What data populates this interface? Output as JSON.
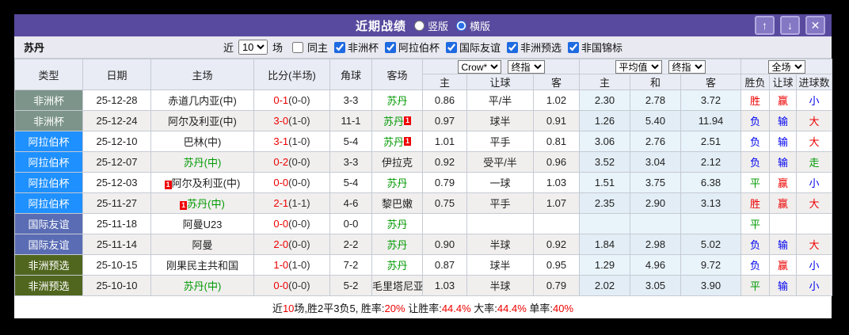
{
  "colors": {
    "accent_purple": "#584a9e",
    "sudan_green": "#009900",
    "score_red": "#ee0000",
    "badge_red": "#ee0000",
    "result_red": "#ee0000",
    "result_blue": "#0000ee",
    "result_green": "#009900",
    "type_colors": {
      "africa_cup": "#7c948a",
      "arab_cup": "#1e90ff",
      "friendly": "#5a6cb4",
      "africa_qual": "#50661e"
    }
  },
  "titlebar": {
    "title": "近期战绩",
    "radio_vertical": "竖版",
    "radio_horizontal": "横版",
    "up_icon": "↑",
    "down_icon": "↓",
    "close_icon": "✕"
  },
  "filterbar": {
    "team": "苏丹",
    "near_label": "近",
    "count_value": "10",
    "matches_label": "场",
    "same_home_label": "同主",
    "filters": [
      "非洲杯",
      "阿拉伯杯",
      "国际友谊",
      "非洲预选",
      "非国锦标"
    ]
  },
  "table": {
    "headers": {
      "type": "类型",
      "date": "日期",
      "home": "主场",
      "score": "比分(半场)",
      "corners": "角球",
      "away": "客场",
      "sub_home1": "主",
      "sub_handicap1": "让球",
      "sub_away1": "客",
      "sub_home2": "主",
      "sub_draw": "和",
      "sub_away2": "客",
      "sub_result": "胜负",
      "sub_handicap2": "让球",
      "sub_goals": "进球数"
    },
    "selects": {
      "odds_source": "Crow*",
      "final_odds_1": "终指",
      "average": "平均值",
      "final_odds_2": "终指",
      "scope": "全场"
    },
    "result_color_map": {
      "胜": "#ee0000",
      "负": "#0000ee",
      "平": "#009900",
      "赢": "#ee0000",
      "输": "#0000ee",
      "大": "#ee0000",
      "小": "#0000ee",
      "走": "#009900"
    },
    "rows": [
      {
        "type": "非洲杯",
        "type_key": "africa_cup",
        "date": "25-12-28",
        "home": "赤道几内亚(中)",
        "home_badge": false,
        "home_sudan": false,
        "score": "0-1",
        "half": "(0-0)",
        "corners": "3-3",
        "away": "苏丹",
        "away_badge": false,
        "away_sudan": true,
        "odds_home": "0.86",
        "handicap": "平/半",
        "odds_away": "1.02",
        "avg_home": "2.30",
        "avg_draw": "2.78",
        "avg_away": "3.72",
        "result": "胜",
        "handicap_result": "赢",
        "goals": "小"
      },
      {
        "type": "非洲杯",
        "type_key": "africa_cup",
        "date": "25-12-24",
        "home": "阿尔及利亚(中)",
        "home_badge": false,
        "home_sudan": false,
        "score": "3-0",
        "half": "(1-0)",
        "corners": "11-1",
        "away": "苏丹",
        "away_badge": true,
        "away_sudan": true,
        "odds_home": "0.97",
        "handicap": "球半",
        "odds_away": "0.91",
        "avg_home": "1.26",
        "avg_draw": "5.40",
        "avg_away": "11.94",
        "result": "负",
        "handicap_result": "输",
        "goals": "大"
      },
      {
        "type": "阿拉伯杯",
        "type_key": "arab_cup",
        "date": "25-12-10",
        "home": "巴林(中)",
        "home_badge": false,
        "home_sudan": false,
        "score": "3-1",
        "half": "(1-0)",
        "corners": "5-4",
        "away": "苏丹",
        "away_badge": true,
        "away_sudan": true,
        "odds_home": "1.01",
        "handicap": "平手",
        "odds_away": "0.81",
        "avg_home": "3.06",
        "avg_draw": "2.76",
        "avg_away": "2.51",
        "result": "负",
        "handicap_result": "输",
        "goals": "大"
      },
      {
        "type": "阿拉伯杯",
        "type_key": "arab_cup",
        "date": "25-12-07",
        "home": "苏丹(中)",
        "home_badge": false,
        "home_sudan": true,
        "score": "0-2",
        "half": "(0-0)",
        "corners": "3-3",
        "away": "伊拉克",
        "away_badge": false,
        "away_sudan": false,
        "odds_home": "0.92",
        "handicap": "受平/半",
        "odds_away": "0.96",
        "avg_home": "3.52",
        "avg_draw": "3.04",
        "avg_away": "2.12",
        "result": "负",
        "handicap_result": "输",
        "goals": "走"
      },
      {
        "type": "阿拉伯杯",
        "type_key": "arab_cup",
        "date": "25-12-03",
        "home": "阿尔及利亚(中)",
        "home_badge": true,
        "home_sudan": false,
        "score": "0-0",
        "half": "(0-0)",
        "corners": "5-4",
        "away": "苏丹",
        "away_badge": false,
        "away_sudan": true,
        "odds_home": "0.79",
        "handicap": "一球",
        "odds_away": "1.03",
        "avg_home": "1.51",
        "avg_draw": "3.75",
        "avg_away": "6.38",
        "result": "平",
        "handicap_result": "赢",
        "goals": "小"
      },
      {
        "type": "阿拉伯杯",
        "type_key": "arab_cup",
        "date": "25-11-27",
        "home": "苏丹(中)",
        "home_badge": true,
        "home_sudan": true,
        "score": "2-1",
        "half": "(1-1)",
        "corners": "4-6",
        "away": "黎巴嫩",
        "away_badge": false,
        "away_sudan": false,
        "odds_home": "0.75",
        "handicap": "平手",
        "odds_away": "1.07",
        "avg_home": "2.35",
        "avg_draw": "2.90",
        "avg_away": "3.13",
        "result": "胜",
        "handicap_result": "赢",
        "goals": "大"
      },
      {
        "type": "国际友谊",
        "type_key": "friendly",
        "date": "25-11-18",
        "home": "阿曼U23",
        "home_badge": false,
        "home_sudan": false,
        "score": "0-0",
        "half": "(0-0)",
        "corners": "0-0",
        "away": "苏丹",
        "away_badge": false,
        "away_sudan": true,
        "odds_home": "",
        "handicap": "",
        "odds_away": "",
        "avg_home": "",
        "avg_draw": "",
        "avg_away": "",
        "result": "平",
        "handicap_result": "",
        "goals": ""
      },
      {
        "type": "国际友谊",
        "type_key": "friendly",
        "date": "25-11-14",
        "home": "阿曼",
        "home_badge": false,
        "home_sudan": false,
        "score": "2-0",
        "half": "(0-0)",
        "corners": "2-2",
        "away": "苏丹",
        "away_badge": false,
        "away_sudan": true,
        "odds_home": "0.90",
        "handicap": "半球",
        "odds_away": "0.92",
        "avg_home": "1.84",
        "avg_draw": "2.98",
        "avg_away": "5.02",
        "result": "负",
        "handicap_result": "输",
        "goals": "大"
      },
      {
        "type": "非洲预选",
        "type_key": "africa_qual",
        "date": "25-10-15",
        "home": "刚果民主共和国",
        "home_badge": false,
        "home_sudan": false,
        "score": "1-0",
        "half": "(1-0)",
        "corners": "7-2",
        "away": "苏丹",
        "away_badge": false,
        "away_sudan": true,
        "odds_home": "0.87",
        "handicap": "球半",
        "odds_away": "0.95",
        "avg_home": "1.29",
        "avg_draw": "4.96",
        "avg_away": "9.72",
        "result": "负",
        "handicap_result": "赢",
        "goals": "小"
      },
      {
        "type": "非洲预选",
        "type_key": "africa_qual",
        "date": "25-10-10",
        "home": "苏丹(中)",
        "home_badge": false,
        "home_sudan": true,
        "score": "0-0",
        "half": "(0-0)",
        "corners": "5-2",
        "away": "毛里塔尼亚",
        "away_badge": false,
        "away_sudan": false,
        "odds_home": "1.03",
        "handicap": "半球",
        "odds_away": "0.79",
        "avg_home": "2.02",
        "avg_draw": "3.05",
        "avg_away": "3.90",
        "result": "平",
        "handicap_result": "输",
        "goals": "小"
      }
    ],
    "badge_label": "1"
  },
  "footer": {
    "segments": [
      {
        "text": "近",
        "red": false
      },
      {
        "text": "10",
        "red": true
      },
      {
        "text": "场,胜2平3负5, 胜率:",
        "red": false
      },
      {
        "text": "20%",
        "red": true
      },
      {
        "text": " 让胜率:",
        "red": false
      },
      {
        "text": "44.4%",
        "red": true
      },
      {
        "text": " 大率:",
        "red": false
      },
      {
        "text": "44.4%",
        "red": true
      },
      {
        "text": " 单率:",
        "red": false
      },
      {
        "text": "40%",
        "red": true
      }
    ]
  }
}
